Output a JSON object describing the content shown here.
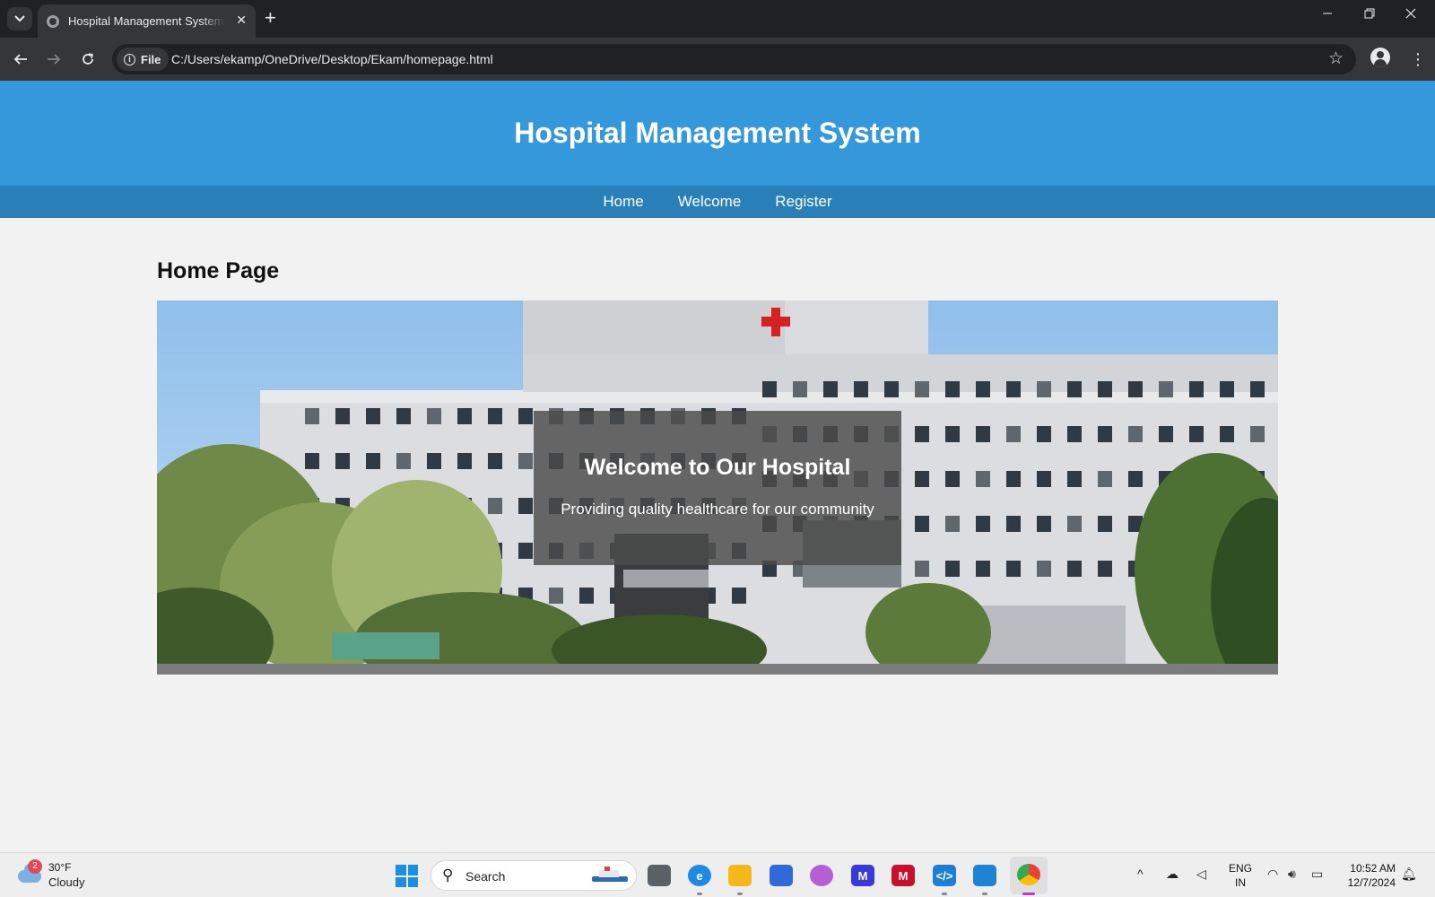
{
  "browser": {
    "tab_title": "Hospital Management System - ",
    "new_tab": "+",
    "close_tab": "✕",
    "address_chip": "File",
    "url": "C:/Users/ekamp/OneDrive/Desktop/Ekam/homepage.html"
  },
  "site": {
    "header_title": "Hospital Management System",
    "nav": [
      "Home",
      "Welcome",
      "Register"
    ],
    "page_heading": "Home Page",
    "hero_title": "Welcome to Our Hospital",
    "hero_subtitle": "Providing quality healthcare for our community"
  },
  "taskbar": {
    "weather_badge": "2",
    "temperature": "30°F",
    "condition": "Cloudy",
    "search_label": "Search",
    "language_top": "ENG",
    "language_bottom": "IN",
    "time": "10:52 AM",
    "date": "12/7/2024"
  },
  "colors": {
    "header": "#3498db",
    "nav": "#2980b9",
    "page_bg": "#f2f2f2"
  }
}
